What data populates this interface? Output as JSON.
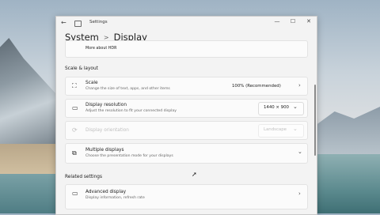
{
  "window": {
    "title": "Settings",
    "back_icon": "back-arrow-icon",
    "controls": {
      "minimize": "—",
      "maximize": "☐",
      "close": "✕"
    }
  },
  "breadcrumb": {
    "parent": "System",
    "separator": ">",
    "current": "Display"
  },
  "top_card": {
    "title": "More about HDR"
  },
  "scale_layout": {
    "heading": "Scale & layout",
    "scale": {
      "title": "Scale",
      "desc": "Change the size of text, apps, and other items",
      "value": "100% (Recommended)"
    },
    "resolution": {
      "title": "Display resolution",
      "desc": "Adjust the resolution to fit your connected display",
      "value": "1440 × 900"
    },
    "orientation": {
      "title": "Display orientation",
      "value": "Landscape"
    },
    "multiple_displays": {
      "title": "Multiple displays",
      "desc": "Choose the presentation mode for your displays"
    }
  },
  "related": {
    "heading": "Related settings",
    "advanced_display": {
      "title": "Advanced display",
      "desc": "Display information, refresh rate"
    }
  }
}
